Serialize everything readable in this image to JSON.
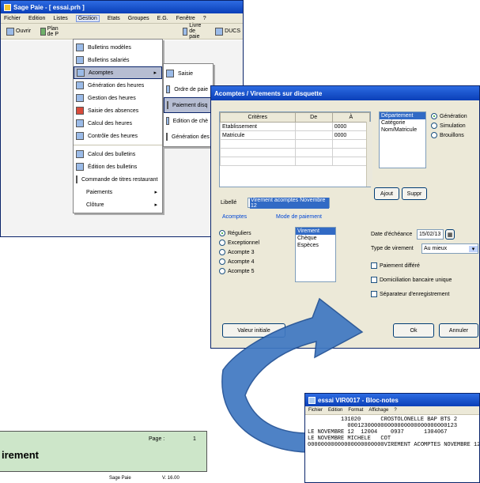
{
  "main_window": {
    "title": "Sage Paie - [ essai.prh ]",
    "menu": [
      "Fichier",
      "Edition",
      "Listes",
      "Gestion",
      "Etats",
      "Groupes",
      "E.G.",
      "Fenêtre",
      "?"
    ],
    "active_menu_index": 3,
    "toolbar": [
      {
        "icon": "document-icon",
        "label": "Ouvrir"
      },
      {
        "icon": "chart-icon",
        "label": "Plan de P"
      },
      {
        "icon": "book-icon",
        "label": "Livre de paie"
      },
      {
        "icon": "help-icon",
        "label": "DUCS"
      }
    ]
  },
  "gestion_menu": {
    "items": [
      {
        "icon": "doc-icon",
        "label": "Bulletins modèles"
      },
      {
        "icon": "doc-icon",
        "label": "Bulletins salariés"
      },
      {
        "icon": "doc-icon",
        "label": "Acomptes",
        "selected": true
      },
      {
        "icon": "gear-icon",
        "label": "Génération des heures"
      },
      {
        "icon": "clock-icon",
        "label": "Gestion des heures"
      },
      {
        "icon": "save-icon",
        "label": "Saisie des absences"
      },
      {
        "icon": "calc-icon",
        "label": "Calcul des heures"
      },
      {
        "icon": "check-icon",
        "label": "Contrôle des heures"
      },
      {
        "icon": "calc-icon",
        "label": "Calcul des bulletins"
      },
      {
        "icon": "print-icon",
        "label": "Édition des bulletins"
      },
      {
        "icon": "tickets-icon",
        "label": "Commande de titres restaurant"
      },
      {
        "icon": "",
        "label": "Paiements",
        "submenu": true
      },
      {
        "icon": "",
        "label": "Clôture",
        "submenu": true
      }
    ]
  },
  "acomptes_submenu": {
    "items": [
      {
        "icon": "doc-icon",
        "label": "Saisie"
      },
      {
        "icon": "doc-icon",
        "label": "Ordre de paie"
      },
      {
        "icon": "doc-icon",
        "label": "Paiement disq",
        "selected": true
      },
      {
        "icon": "doc-icon",
        "label": "Edition de chè"
      },
      {
        "icon": "doc-icon",
        "label": "Génération des"
      }
    ]
  },
  "dialog": {
    "title": "Acomptes / Virements sur disquette",
    "grid_headers": [
      "Critères",
      "De",
      "À"
    ],
    "grid_rows": [
      [
        "Etablissement",
        "",
        "0000"
      ],
      [
        "Matricule",
        "",
        "0000"
      ],
      [
        "",
        "",
        ""
      ],
      [
        "",
        "",
        ""
      ],
      [
        "",
        "",
        ""
      ],
      [
        "",
        "",
        ""
      ]
    ],
    "sort_options": [
      "Département",
      "Catégorie",
      "Nom/Matricule"
    ],
    "output_options": [
      {
        "label": "Génération",
        "checked": true
      },
      {
        "label": "Simulation",
        "checked": false
      },
      {
        "label": "Brouillons",
        "checked": false
      }
    ],
    "btn_ajouter": "Ajout",
    "btn_supprimer": "Suppr",
    "libelle_label": "Libellé",
    "libelle_value": "Virement acomptes Novembre 12",
    "acomptes_title": "Acomptes",
    "acomptes_options": [
      {
        "label": "Réguliers",
        "checked": true
      },
      {
        "label": "Exceptionnel",
        "checked": false
      },
      {
        "label": "Acompte 3",
        "checked": false
      },
      {
        "label": "Acompte 4",
        "checked": false
      },
      {
        "label": "Acompte 5",
        "checked": false
      }
    ],
    "mode_title": "Mode de paiement",
    "mode_options": [
      "Virement",
      "Chèque",
      "Espèces"
    ],
    "date_label": "Date d'échéance",
    "date_value": "15/02/13",
    "type_label": "Type de virement",
    "type_value": "Au mieux",
    "checkboxes": [
      "Paiement différé",
      "Domiciliation bancaire unique",
      "Séparateur d'enregistrement"
    ],
    "btn_left": "Valeur initiale",
    "btn_ok": "Ok",
    "btn_cancel": "Annuler"
  },
  "notepad": {
    "title": "essai VIR0017 - Bloc-notes",
    "menu": [
      "Fichier",
      "Edition",
      "Format",
      "Affichage",
      "?"
    ],
    "lines": [
      "          131020      CROSTOLONELLE BAP BTS 2",
      "            000123000000000000000000000000123",
      "LE NOVEMBRE 12  12004    0937      1304067",
      "LE NOVEMBRE MICHELE   COT",
      "00000000000000000000000VIREMENT ACOMPTES NOVEMBRE 12"
    ]
  },
  "report": {
    "title": "irement",
    "page_label": "Page :",
    "page_number": "1",
    "footer_left": "Sage Paie",
    "footer_right": "V. 16.00"
  }
}
